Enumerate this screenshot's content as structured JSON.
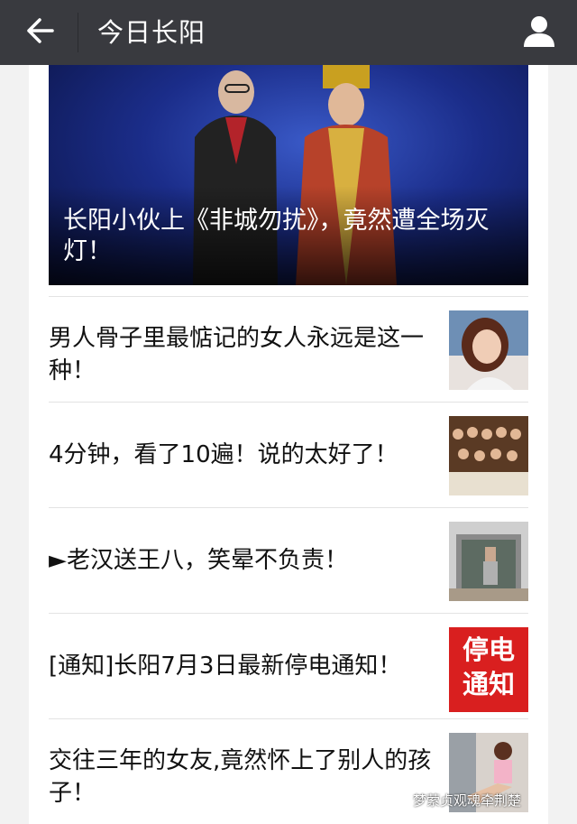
{
  "header": {
    "title": "今日长阳",
    "back_icon": "arrow-left-icon",
    "profile_icon": "user-icon"
  },
  "hero": {
    "caption": "长阳小伙上《非城勿扰》，竟然遭全场灭灯！"
  },
  "articles": [
    {
      "title": "男人骨子里最惦记的女人永远是这一种！",
      "thumb": "woman-portrait-photo"
    },
    {
      "title": "4分钟，看了10遍！说的太好了！",
      "thumb": "group-dinner-photo"
    },
    {
      "title": "►老汉送王八，笑晕不负责！",
      "thumb": "old-man-gate-photo"
    },
    {
      "title": "[通知]长阳7月3日最新停电通知！",
      "thumb": "power-outage-notice",
      "thumb_text_1": "停电",
      "thumb_text_2": "通知"
    },
    {
      "title": "交往三年的女友,竟然怀上了别人的孩子！",
      "thumb": "woman-sitting-photo"
    }
  ],
  "watermark": "梦萦贞观魂牵荆楚"
}
